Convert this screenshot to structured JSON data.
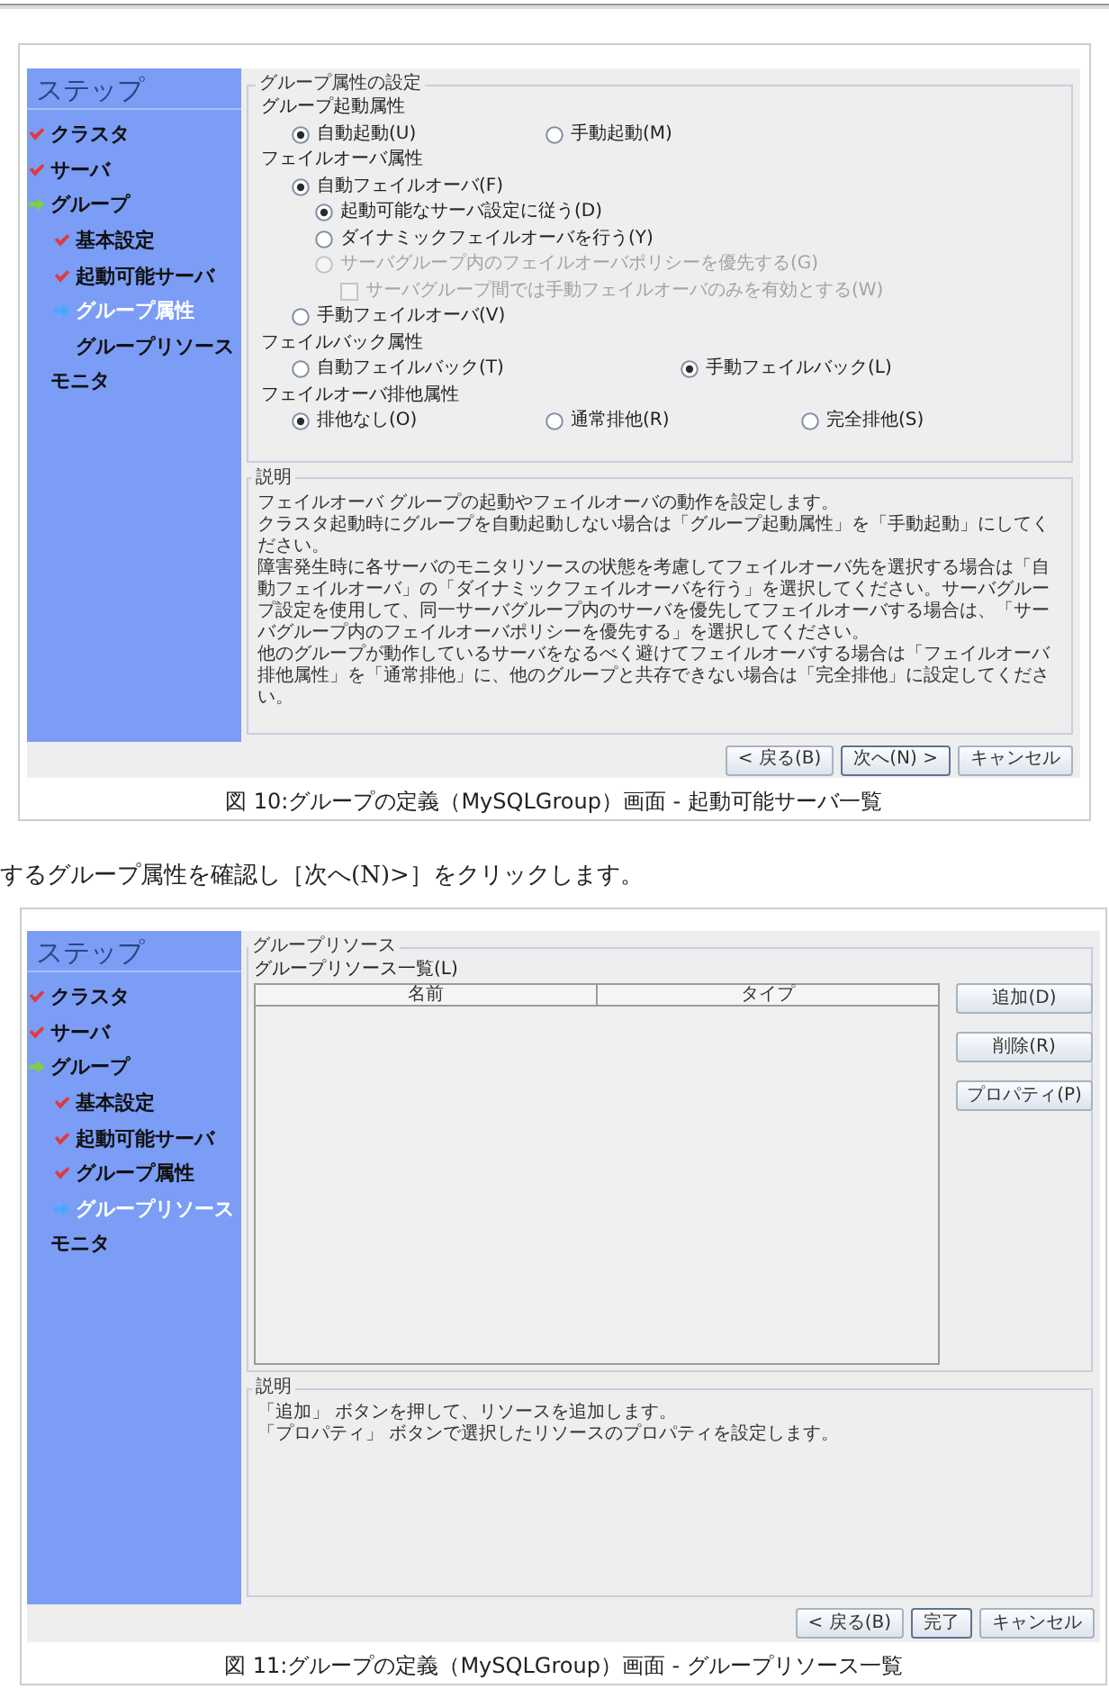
{
  "content": [
    {
      "kind": "figure",
      "sidebar": {
        "title": "ステップ",
        "items": [
          {
            "label": "クラスタ",
            "completed": true,
            "in_progress": false,
            "selected": false
          },
          {
            "label": "サーバ",
            "completed": true,
            "in_progress": false,
            "selected": false
          },
          {
            "label": "グループ",
            "completed": false,
            "in_progress": true,
            "selected": false,
            "children": [
              {
                "label": "基本設定",
                "completed": true,
                "in_progress": false,
                "selected": false
              },
              {
                "label": "起動可能サーバ",
                "completed": true,
                "in_progress": false,
                "selected": false
              },
              {
                "label": "グループ属性",
                "completed": false,
                "in_progress": false,
                "selected": true
              },
              {
                "label": "グループリソース",
                "completed": false,
                "in_progress": false,
                "selected": false
              }
            ]
          },
          {
            "label": "モニタ",
            "completed": false,
            "in_progress": false,
            "selected": false
          }
        ]
      },
      "panel": {
        "kind": "attributes",
        "title": "グループ属性の設定",
        "sections": [
          {
            "label": "グループ起動属性",
            "options": [
              {
                "kind": "radio",
                "label": "自動起動(U)",
                "selected": true,
                "disabled": false
              },
              {
                "kind": "radio",
                "label": "手動起動(M)",
                "selected": false,
                "disabled": false
              }
            ]
          },
          {
            "label": "フェイルオーバ属性",
            "options": [
              {
                "kind": "radio",
                "label": "自動フェイルオーバ(F)",
                "selected": true,
                "disabled": false,
                "children": [
                  {
                    "kind": "radio",
                    "label": "起動可能なサーバ設定に従う(D)",
                    "selected": true,
                    "disabled": false
                  },
                  {
                    "kind": "radio",
                    "label": "ダイナミックフェイルオーバを行う(Y)",
                    "selected": false,
                    "disabled": false
                  },
                  {
                    "kind": "radio",
                    "label": "サーバグループ内のフェイルオーバポリシーを優先する(G)",
                    "selected": false,
                    "disabled": true,
                    "children": [
                      {
                        "kind": "checkbox",
                        "label": "サーバグループ間では手動フェイルオーバのみを有効とする(W)",
                        "checked": false,
                        "disabled": true
                      }
                    ]
                  }
                ]
              },
              {
                "kind": "radio",
                "label": "手動フェイルオーバ(V)",
                "selected": false,
                "disabled": false
              }
            ]
          },
          {
            "label": "フェイルバック属性",
            "options": [
              {
                "kind": "radio",
                "label": "自動フェイルバック(T)",
                "selected": false,
                "disabled": false
              },
              {
                "kind": "radio",
                "label": "手動フェイルバック(L)",
                "selected": true,
                "disabled": false
              }
            ]
          },
          {
            "label": "フェイルオーバ排他属性",
            "options": [
              {
                "kind": "radio",
                "label": "排他なし(O)",
                "selected": true,
                "disabled": false
              },
              {
                "kind": "radio",
                "label": "通常排他(R)",
                "selected": false,
                "disabled": false
              },
              {
                "kind": "radio",
                "label": "完全排他(S)",
                "selected": false,
                "disabled": false
              }
            ]
          }
        ]
      },
      "description": {
        "title": "説明",
        "paragraphs": [
          "フェイルオーバ グループの起動やフェイルオーバの動作を設定します。",
          "クラスタ起動時にグループを自動起動しない場合は「グループ起動属性」を「手動起動」にしてください。",
          "障害発生時に各サーバのモニタリソースの状態を考慮してフェイルオーバ先を選択する場合は「自動フェイルオーバ」の「ダイナミックフェイルオーバを行う」を選択してください。サーバグループ設定を使用して、同一サーバグループ内のサーバを優先してフェイルオーバする場合は、「サーバグループ内のフェイルオーバポリシーを優先する」を選択してください。",
          "他のグループが動作しているサーバをなるべく避けてフェイルオーバする場合は「フェイルオーバ排他属性」を「通常排他」に、他のグループと共存できない場合は「完全排他」に設定してください。"
        ]
      },
      "buttons": [
        {
          "label": "< 戻る(B)",
          "default": false
        },
        {
          "label": "次へ(N) >",
          "default": true
        },
        {
          "label": "キャンセル",
          "default": false
        }
      ],
      "caption": "図 10:グループの定義（MySQLGroup）画面 - 起動可能サーバ一覧"
    },
    {
      "kind": "paragraph",
      "text": "するグループ属性を確認し［次へ(N)>］をクリックします。"
    },
    {
      "kind": "figure",
      "sidebar": {
        "title": "ステップ",
        "items": [
          {
            "label": "クラスタ",
            "completed": true,
            "in_progress": false,
            "selected": false
          },
          {
            "label": "サーバ",
            "completed": true,
            "in_progress": false,
            "selected": false
          },
          {
            "label": "グループ",
            "completed": false,
            "in_progress": true,
            "selected": false,
            "children": [
              {
                "label": "基本設定",
                "completed": true,
                "in_progress": false,
                "selected": false
              },
              {
                "label": "起動可能サーバ",
                "completed": true,
                "in_progress": false,
                "selected": false
              },
              {
                "label": "グループ属性",
                "completed": true,
                "in_progress": false,
                "selected": false
              },
              {
                "label": "グループリソース",
                "completed": false,
                "in_progress": false,
                "selected": true
              }
            ]
          },
          {
            "label": "モニタ",
            "completed": false,
            "in_progress": false,
            "selected": false
          }
        ]
      },
      "panel": {
        "kind": "resources",
        "title": "グループリソース",
        "list_label": "グループリソース一覧(L)",
        "columns": [
          "名前",
          "タイプ"
        ],
        "actions": [
          "追加(D)",
          "削除(R)",
          "プロパティ(P)"
        ]
      },
      "description": {
        "title": "説明",
        "paragraphs": [
          "「追加」 ボタンを押して、リソースを追加します。",
          "「プロパティ」 ボタンで選択したリソースのプロパティを設定します。"
        ]
      },
      "buttons": [
        {
          "label": "< 戻る(B)",
          "default": false
        },
        {
          "label": "完了",
          "default": true
        },
        {
          "label": "キャンセル",
          "default": false
        }
      ],
      "caption": "図 11:グループの定義（MySQLGroup）画面 - グループリソース一覧"
    }
  ]
}
